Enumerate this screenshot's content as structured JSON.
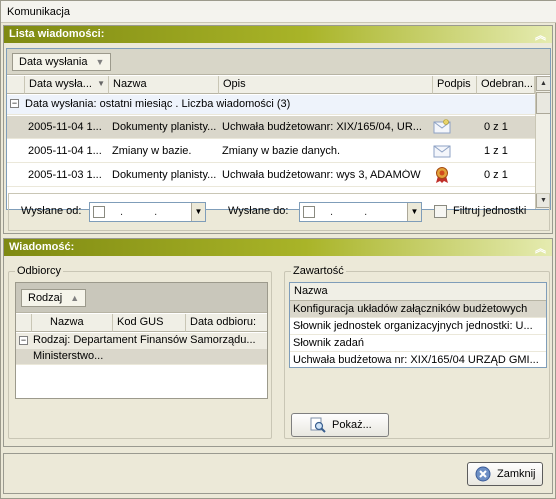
{
  "window": {
    "title": "Komunikacja"
  },
  "list_panel": {
    "title": "Lista wiadomości:",
    "group_button": "Data wysłania",
    "columns": [
      "Data wysła...",
      "Nazwa",
      "Opis",
      "Podpis",
      "Odebran..."
    ],
    "group_row": "Data wysłania:  ostatni miesiąc . Liczba wiadomości (3)",
    "rows": [
      {
        "date": "2005-11-04  1...",
        "name": "Dokumenty  planisty...",
        "desc": "Uchwała budżetowanr: XIX/165/04,  UR...",
        "sign": "envelope-icon",
        "received": "0 z 1"
      },
      {
        "date": "2005-11-04  1...",
        "name": "Zmiany w bazie.",
        "desc": "Zmiany w bazie danych.",
        "sign": "envelope-icon",
        "received": "1 z 1"
      },
      {
        "date": "2005-11-03  1...",
        "name": "Dokumenty  planisty...",
        "desc": "Uchwała budżetowanr: wys 3,  ADAMÓW",
        "sign": "seal-icon",
        "received": "0 z 1"
      }
    ],
    "filter": {
      "from_label": "Wysłane od:",
      "to_label": "Wysłane do:",
      "from_value": ". .",
      "to_value": ". .",
      "checkbox_label": "Filtruj jednostki"
    }
  },
  "message_panel": {
    "title": "Wiadomość:",
    "recipients": {
      "legend": "Odbiorcy",
      "group_button": "Rodzaj",
      "columns": [
        "Nazwa",
        "Kod GUS",
        "Data odbioru:"
      ],
      "group_row": "Rodzaj:  Departament Finansów  Samorządu...",
      "rows": [
        {
          "name": "Ministerstwo...",
          "code": "",
          "date": ""
        }
      ]
    },
    "content": {
      "legend": "Zawartość",
      "column": "Nazwa",
      "items": [
        "Konfiguracja układów załączników budżetowych",
        "Słownik jednostek organizacyjnych jednostki: U...",
        "Słownik zadań",
        "Uchwała budżetowa nr: XIX/165/04 URZĄD GMI..."
      ],
      "show_button": "Pokaż..."
    }
  },
  "footer": {
    "close_button": "Zamknij"
  },
  "colors": {
    "panel_header": "#8f9a1c",
    "selection": "#dad7cb",
    "background": "#ece9d8"
  }
}
